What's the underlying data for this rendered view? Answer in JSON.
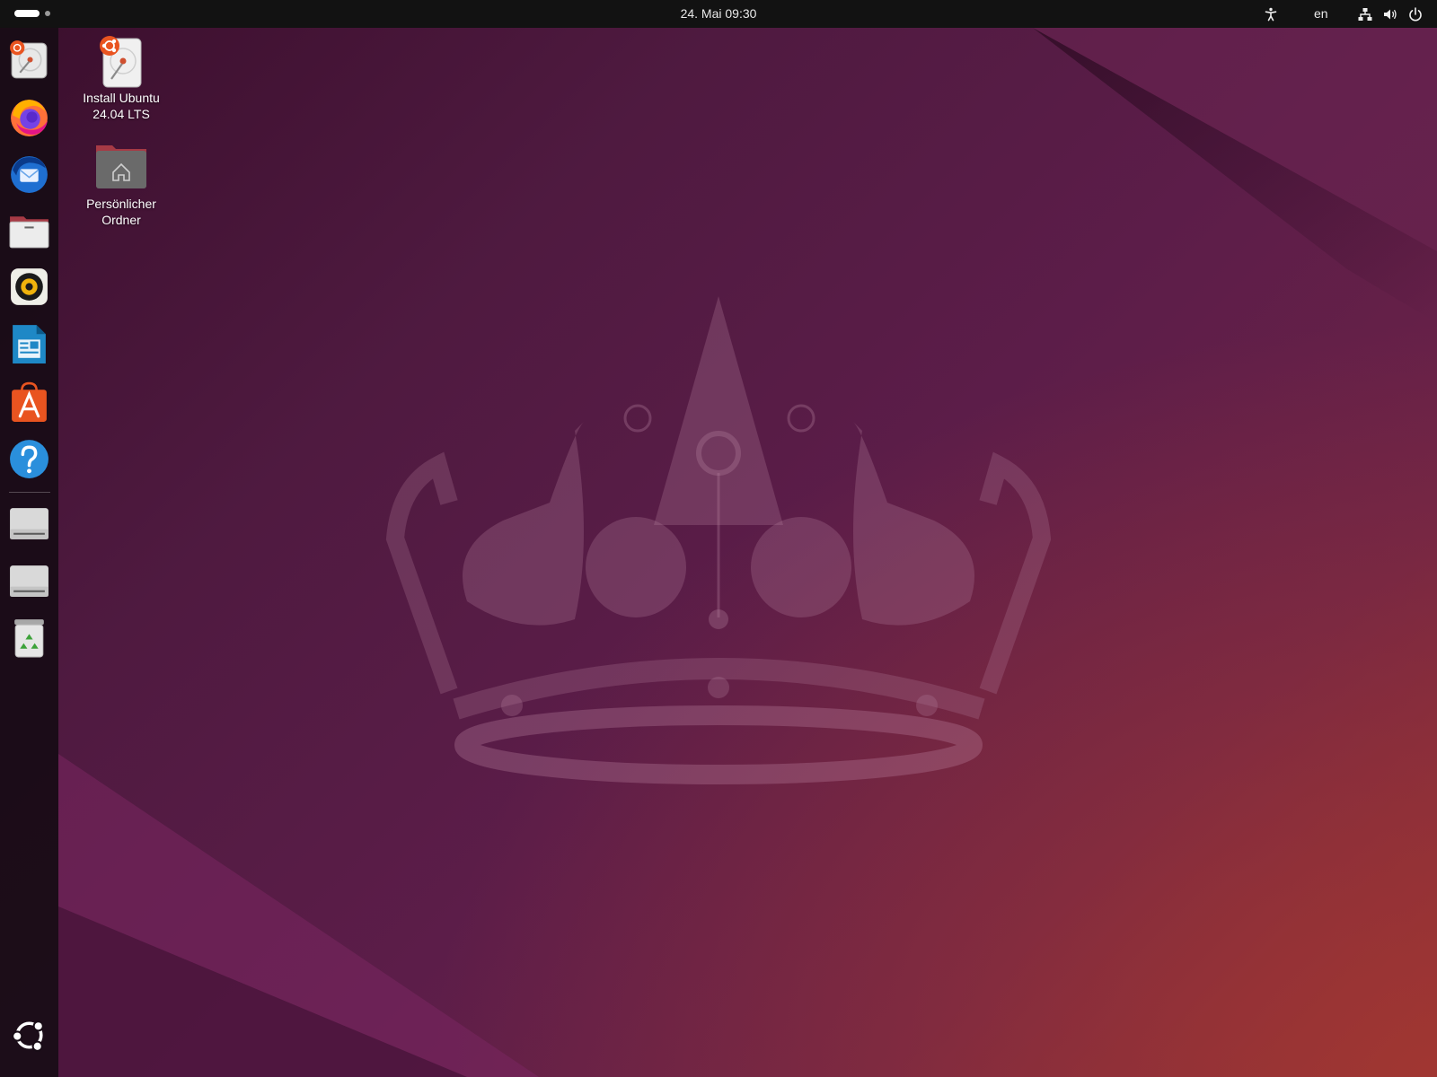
{
  "topbar": {
    "datetime": "24. Mai  09:30",
    "keyboard_layout": "en",
    "icons": [
      "accessibility-icon",
      "network-icon",
      "volume-icon",
      "power-icon"
    ]
  },
  "dock": {
    "items": [
      {
        "name": "ubuntu-installer-icon"
      },
      {
        "name": "firefox-icon"
      },
      {
        "name": "thunderbird-icon"
      },
      {
        "name": "files-icon"
      },
      {
        "name": "rhythmbox-icon"
      },
      {
        "name": "libreoffice-writer-icon"
      },
      {
        "name": "app-center-icon"
      },
      {
        "name": "help-icon"
      },
      {
        "name": "drive-icon"
      },
      {
        "name": "drive-icon"
      },
      {
        "name": "trash-icon"
      },
      {
        "name": "show-apps-icon"
      }
    ]
  },
  "desktop": {
    "icons": [
      {
        "label_line1": "Install Ubuntu",
        "label_line2": "24.04 LTS"
      },
      {
        "label_line1": "Persönlicher",
        "label_line2": "Ordner"
      }
    ]
  },
  "colors": {
    "topbar": "#121212",
    "ubuntu_orange": "#e95420",
    "wallpaper_dark": "#3a0e2c",
    "wallpaper_light": "#8a2c36"
  }
}
